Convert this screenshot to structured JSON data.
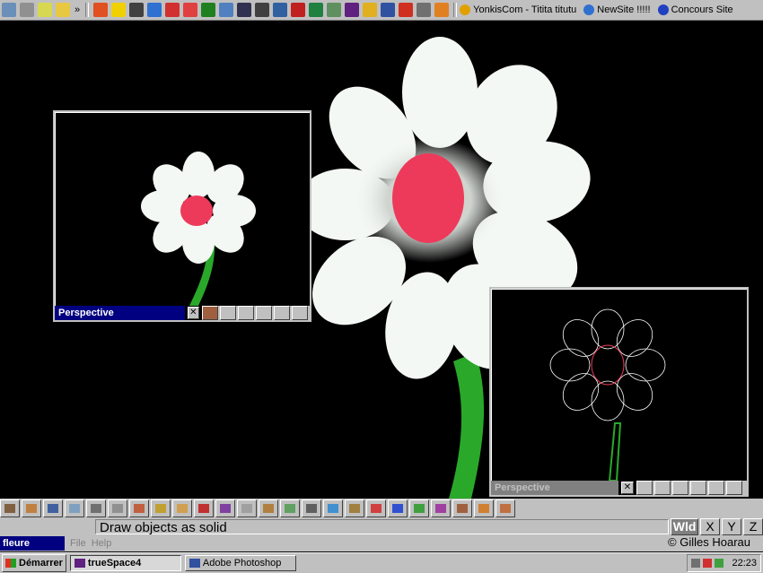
{
  "top_toolbar": {
    "quick_icons": [
      "desktop-icon",
      "drive-icon",
      "search-icon",
      "folder-icon"
    ],
    "more_symbol": "»",
    "app_icons": [
      "runner-icon",
      "warning-icon",
      "pen-icon",
      "ie-icon",
      "lifebuoy-icon",
      "atom-icon",
      "leaf-icon",
      "puzzle-icon",
      "user-icon",
      "cube-icon",
      "picture-icon",
      "chart-icon",
      "globe-icon",
      "map-icon",
      "book-icon",
      "pencil-icon",
      "table-icon",
      "filmstrip-icon",
      "calculator-icon",
      "sun-icon"
    ],
    "links": [
      {
        "label": "YonkisCom - Titita titutu",
        "icon": "yonkis-icon"
      },
      {
        "label": "NewSite !!!!!",
        "icon": "ie-page-icon"
      },
      {
        "label": "Concours Site",
        "icon": "w-icon"
      }
    ]
  },
  "windows": {
    "left": {
      "title": "Perspective"
    },
    "right": {
      "title": "Perspective"
    }
  },
  "status": {
    "message": "Draw objects as solid",
    "axes": [
      "Wld",
      "X",
      "Y",
      "Z"
    ]
  },
  "app": {
    "name": "fleure",
    "menu": [
      "File",
      "Help"
    ],
    "copyright": "© Gilles Hoarau"
  },
  "taskbar": {
    "start_label": "Démarrer",
    "tasks": [
      {
        "label": "trueSpace4",
        "active": true
      },
      {
        "label": "Adobe Photoshop",
        "active": false
      }
    ],
    "clock": "22:23"
  },
  "colors": {
    "petal": "#f4f8f4",
    "center": "#ee3a5a",
    "stem": "#2aa82a",
    "titlebar": "#000080"
  }
}
